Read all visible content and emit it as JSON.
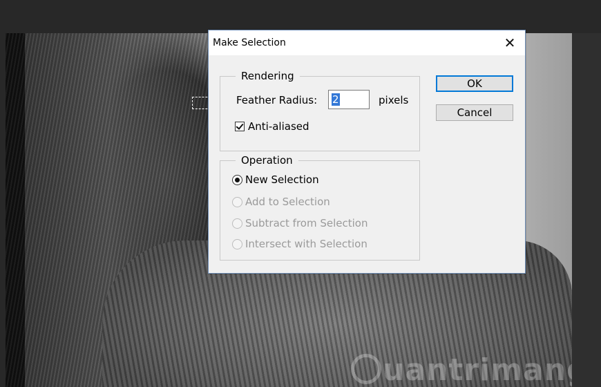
{
  "dialog": {
    "title": "Make Selection",
    "close_icon": "close-icon",
    "rendering": {
      "legend": "Rendering",
      "feather_label": "Feather Radius:",
      "feather_value": "2",
      "feather_unit": "pixels",
      "anti_aliased_label": "Anti-aliased",
      "anti_aliased_checked": true
    },
    "operation": {
      "legend": "Operation",
      "options": [
        {
          "label": "New Selection",
          "selected": true,
          "enabled": true
        },
        {
          "label": "Add to Selection",
          "selected": false,
          "enabled": false
        },
        {
          "label": "Subtract from Selection",
          "selected": false,
          "enabled": false
        },
        {
          "label": "Intersect with Selection",
          "selected": false,
          "enabled": false
        }
      ]
    },
    "buttons": {
      "ok": "OK",
      "cancel": "Cancel"
    }
  },
  "watermark": {
    "text": "uantrimang"
  }
}
